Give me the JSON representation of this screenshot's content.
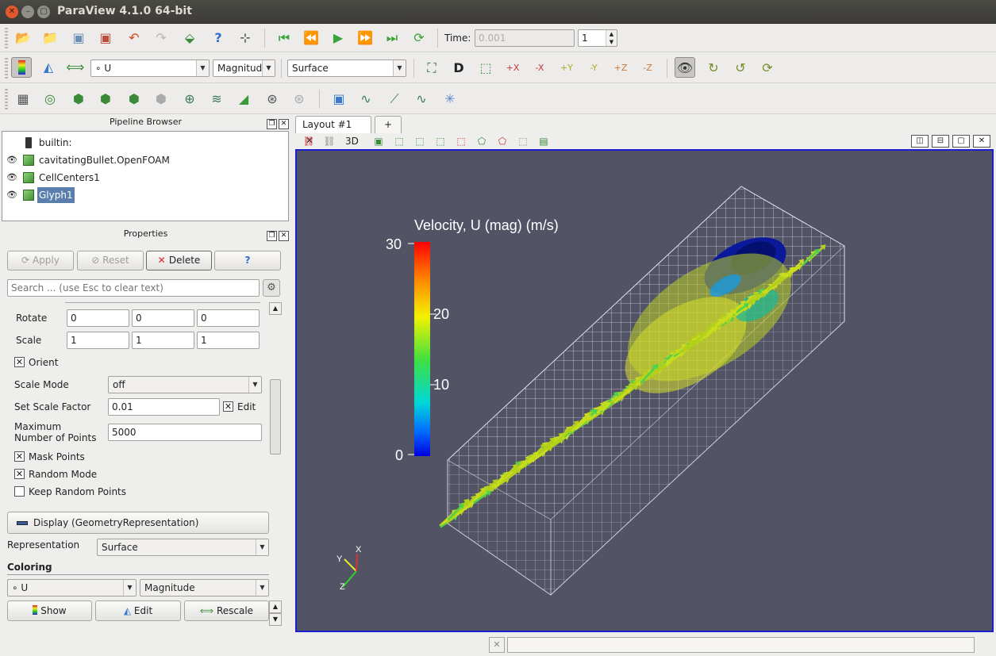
{
  "window": {
    "title": "ParaView 4.1.0 64-bit"
  },
  "toolbar1": {
    "time_label": "Time:",
    "time_value": "0.001",
    "timestep_value": "1"
  },
  "toolbar2": {
    "array_combo": "U",
    "component_combo": "Magnitude",
    "representation_combo": "Surface"
  },
  "pipeline_browser": {
    "title": "Pipeline Browser",
    "items": [
      {
        "label": "builtin:"
      },
      {
        "label": "cavitatingBullet.OpenFOAM"
      },
      {
        "label": "CellCenters1"
      },
      {
        "label": "Glyph1"
      }
    ]
  },
  "properties": {
    "title": "Properties",
    "apply_label": "Apply",
    "reset_label": "Reset",
    "delete_label": "Delete",
    "help_label": "?",
    "search_placeholder": "Search ... (use Esc to clear text)",
    "rotate_label": "Rotate",
    "rotate_values": [
      "0",
      "0",
      "0"
    ],
    "scale_label": "Scale",
    "scale_values": [
      "1",
      "1",
      "1"
    ],
    "orient_label": "Orient",
    "scale_mode_label": "Scale Mode",
    "scale_mode_value": "off",
    "scale_factor_label": "Set Scale Factor",
    "scale_factor_value": "0.01",
    "edit_label": "Edit",
    "max_points_label_1": "Maximum",
    "max_points_label_2": "Number of Points",
    "max_points_value": "5000",
    "mask_points_label": "Mask Points",
    "random_mode_label": "Random Mode",
    "keep_random_label": "Keep Random Points",
    "display_section": "Display (GeometryRepresentation)",
    "representation_label": "Representation",
    "representation_value": "Surface",
    "coloring_label": "Coloring",
    "coloring_array": "U",
    "coloring_component": "Magnitude",
    "show_label": "Show",
    "edit_btn_label": "Edit",
    "rescale_label": "Rescale"
  },
  "layout": {
    "tab_label": "Layout #1",
    "add_tab_label": "+",
    "view_mode_label": "3D"
  },
  "render_view": {
    "colorbar_title": "Velocity, U (mag) (m/s)",
    "colorbar_ticks": [
      "30",
      "20",
      "10",
      "0"
    ],
    "axes": {
      "x": "X",
      "y": "Y",
      "z": "Z"
    },
    "background_color": "#525466"
  }
}
